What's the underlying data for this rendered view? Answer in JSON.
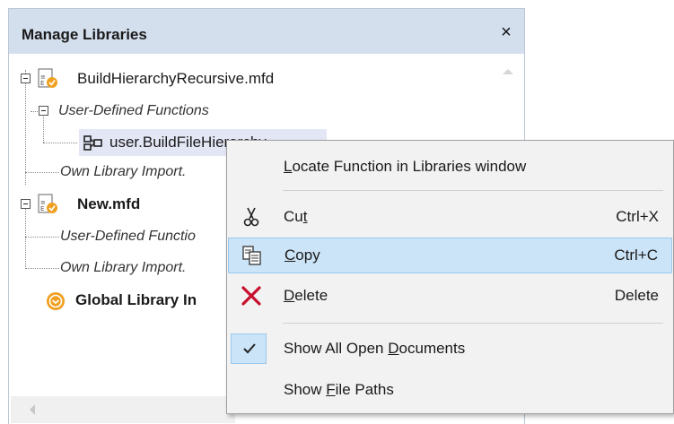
{
  "panel": {
    "title": "Manage Libraries",
    "close_symbol": "×"
  },
  "tree": {
    "file1": {
      "name": "BuildHierarchyRecursive.mfd"
    },
    "udf_group1": {
      "label": "User-Defined Functions"
    },
    "function1": {
      "name": "user.BuildFileHierarchy"
    },
    "own_import1": {
      "label": "Own Library Import."
    },
    "file2": {
      "name": "New.mfd"
    },
    "udf_group2": {
      "label": "User-Defined Functio"
    },
    "own_import2": {
      "label": "Own Library Import."
    },
    "global": {
      "label": "Global Library In"
    }
  },
  "context_menu": {
    "items": [
      {
        "pre": "",
        "ul": "L",
        "post": "ocate Function in Libraries window",
        "shortcut": "",
        "icon": ""
      },
      {
        "pre": "Cu",
        "ul": "t",
        "post": "",
        "shortcut": "Ctrl+X",
        "icon": "scissors-icon"
      },
      {
        "pre": "",
        "ul": "C",
        "post": "opy",
        "shortcut": "Ctrl+C",
        "icon": "copy-icon"
      },
      {
        "pre": "",
        "ul": "D",
        "post": "elete",
        "shortcut": "Delete",
        "icon": "delete-icon"
      },
      {
        "pre": "Show All Open ",
        "ul": "D",
        "post": "ocuments",
        "shortcut": "",
        "icon": "checkmark-icon"
      },
      {
        "pre": "Show ",
        "ul": "F",
        "post": "ile Paths",
        "shortcut": "",
        "icon": ""
      }
    ]
  },
  "colors": {
    "header_bg": "#d4dfee",
    "menu_highlight": "#cce4f7",
    "delete_red": "#c8102e",
    "icon_orange": "#f0a020"
  }
}
